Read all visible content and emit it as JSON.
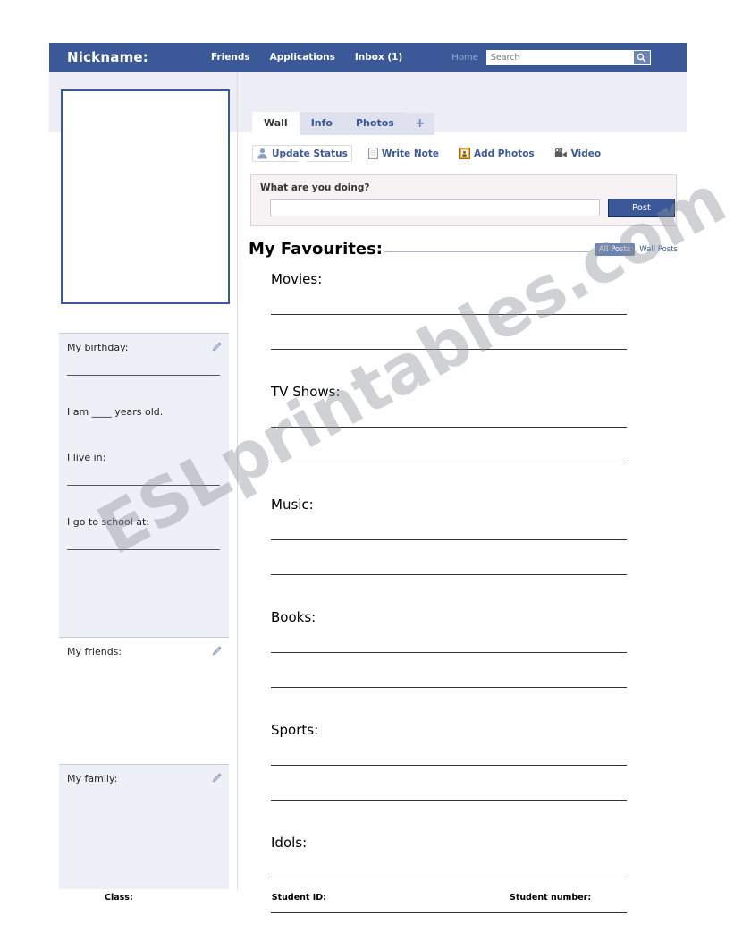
{
  "topbar": {
    "brand": "Nickname:",
    "nav": [
      {
        "label": "Friends"
      },
      {
        "label": "Applications"
      },
      {
        "label": "Inbox (1)"
      }
    ],
    "home_label": "Home",
    "search_placeholder": "Search",
    "search_value": "Search",
    "search_icon": "search-icon",
    "background_color": "#3b5998"
  },
  "tabs": [
    {
      "label": "Wall",
      "active": true
    },
    {
      "label": "Info",
      "active": false
    },
    {
      "label": "Photos",
      "active": false
    },
    {
      "label": "+",
      "active": false
    }
  ],
  "actions": [
    {
      "label": "Update Status",
      "icon": "person-icon",
      "selected": true
    },
    {
      "label": "Write Note",
      "icon": "note-icon",
      "selected": false
    },
    {
      "label": "Add Photos",
      "icon": "photo-icon",
      "selected": false
    },
    {
      "label": "Video",
      "icon": "video-camera-icon",
      "selected": false
    }
  ],
  "composer": {
    "prompt": "What are you doing?",
    "input_value": "",
    "post_label": "Post"
  },
  "favourites": {
    "title": "My Favourites:",
    "filters": [
      {
        "label": "All Posts",
        "active": true
      },
      {
        "label": "Wall Posts",
        "active": false
      }
    ],
    "sections": [
      {
        "label": "Movies:",
        "lines": 2
      },
      {
        "label": "TV Shows:",
        "lines": 2
      },
      {
        "label": "Music:",
        "lines": 2
      },
      {
        "label": "Books:",
        "lines": 2
      },
      {
        "label": "Sports:",
        "lines": 2
      },
      {
        "label": "Idols:",
        "lines": 2
      }
    ]
  },
  "sidebar": {
    "photo_box": {
      "caption": ""
    },
    "about": {
      "title": "My birthday:",
      "edit_icon": "pencil-icon",
      "age_text": "I am ____ years old.",
      "live_text": "I live in:",
      "school_text": "I go to school at:"
    },
    "friends": {
      "title": "My friends:",
      "edit_icon": "pencil-icon"
    },
    "family": {
      "title": "My family:",
      "edit_icon": "pencil-icon"
    }
  },
  "footer": {
    "class_label": "Class:",
    "student_id_label": "Student ID:",
    "student_number_label": "Student number:"
  },
  "watermark": {
    "text": "ESLprintables.com"
  }
}
